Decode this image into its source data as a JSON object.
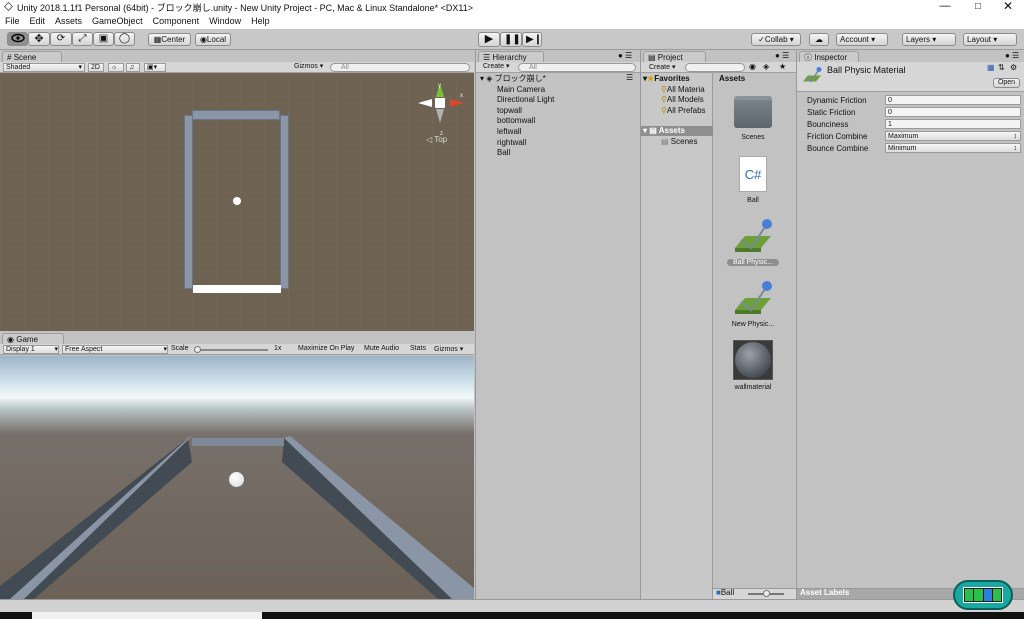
{
  "window": {
    "title": "Unity 2018.1.1f1 Personal (64bit) - ブロック崩し.unity - New Unity Project - PC, Mac & Linux Standalone* <DX11>"
  },
  "menu": [
    "File",
    "Edit",
    "Assets",
    "GameObject",
    "Component",
    "Window",
    "Help"
  ],
  "toolbar": {
    "center": "Center",
    "local": "Local",
    "collab": "Collab",
    "account": "Account",
    "layers": "Layers",
    "layout": "Layout"
  },
  "scene": {
    "tab": "Scene",
    "shading": "Shaded",
    "mode2d": "2D",
    "gizmos": "Gizmos",
    "search": "All",
    "view_label": "Top",
    "axes": {
      "y": "y",
      "x": "x",
      "z": "z"
    }
  },
  "game": {
    "tab": "Game",
    "display": "Display 1",
    "aspect": "Free Aspect",
    "scale_label": "Scale",
    "scale_value": "1x",
    "scale_level": 0.0,
    "maximize": "Maximize On Play",
    "mute": "Mute Audio",
    "stats": "Stats",
    "gizmos": "Gizmos"
  },
  "hierarchy": {
    "tab": "Hierarchy",
    "create": "Create",
    "search": "All",
    "scene_name": "ブロック崩し*",
    "items": [
      "Main Camera",
      "Directional Light",
      "topwall",
      "bottomwall",
      "leftwall",
      "rightwall",
      "Ball"
    ]
  },
  "project": {
    "tab": "Project",
    "create": "Create",
    "favorites_label": "Favorites",
    "favorites": [
      "All Materia",
      "All Models",
      "All Prefabs"
    ],
    "assets_label": "Assets",
    "folders": [
      "Scenes"
    ],
    "breadcrumb": "Assets",
    "assets": [
      {
        "name": "Scenes",
        "icon": "folder-icon"
      },
      {
        "name": "Ball",
        "icon": "csharp-script-icon"
      },
      {
        "name": "Ball Physic...",
        "icon": "physic-material-icon",
        "selected": true
      },
      {
        "name": "New Physic...",
        "icon": "physic-material-icon"
      },
      {
        "name": "wallmaterial",
        "icon": "material-sphere-icon"
      }
    ],
    "footer_item": "Ball"
  },
  "inspector": {
    "tab": "Inspector",
    "title": "Ball Physic Material",
    "open": "Open",
    "asset_labels": "Asset Labels",
    "fields": [
      {
        "label": "Dynamic Friction",
        "value": "0",
        "type": "text"
      },
      {
        "label": "Static Friction",
        "value": "0",
        "type": "text"
      },
      {
        "label": "Bounciness",
        "value": "1",
        "type": "text"
      },
      {
        "label": "Friction Combine",
        "value": "Maximum",
        "type": "select"
      },
      {
        "label": "Bounce Combine",
        "value": "Minimum",
        "type": "select"
      }
    ]
  },
  "colors": {
    "scene_bg": "#6e6253",
    "wall": "#8a95a5",
    "panel": "#c2c2c2",
    "selection": "#3d6ed4"
  }
}
